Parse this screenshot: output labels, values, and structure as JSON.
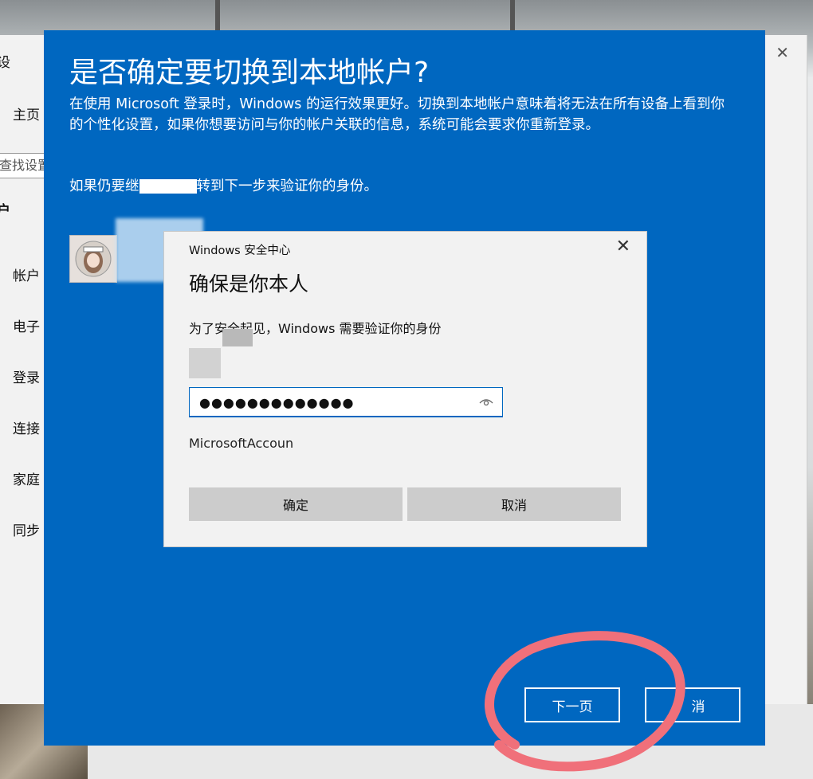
{
  "settings": {
    "close_glyph": "✕",
    "side_items": [
      "主页",
      "户",
      "帐户",
      "电子",
      "登录",
      "连接",
      "家庭",
      "同步"
    ],
    "search_placeholder": "查找设置"
  },
  "switch_dialog": {
    "title": "是否确定要切换到本地帐户?",
    "description": "在使用 Microsoft 登录时，Windows 的运行效果更好。切换到本地帐户意味着将无法在所有设备上看到你的个性化设置，如果你想要访问与你的帐户关联的信息，系统可能会要求你重新登录。",
    "continue_text_start": "如果仍要继",
    "continue_text_end": "转到下一步来验证你的身份。",
    "next_label": "下一页",
    "cancel_label": "取消",
    "cancel_visible": "消"
  },
  "security_dialog": {
    "header": "Windows 安全中心",
    "close_glyph": "✕",
    "heading": "确保是你本人",
    "subtitle": "为了安全起见，Windows 需要验证你的身份",
    "password_mask": "●●●●●●●●●●●●●",
    "account_label": "MicrosoftAccoun",
    "ok_label": "确定",
    "cancel_label": "取消"
  },
  "colors": {
    "dialog_blue": "#0067c0",
    "annotation": "#f0707a"
  }
}
